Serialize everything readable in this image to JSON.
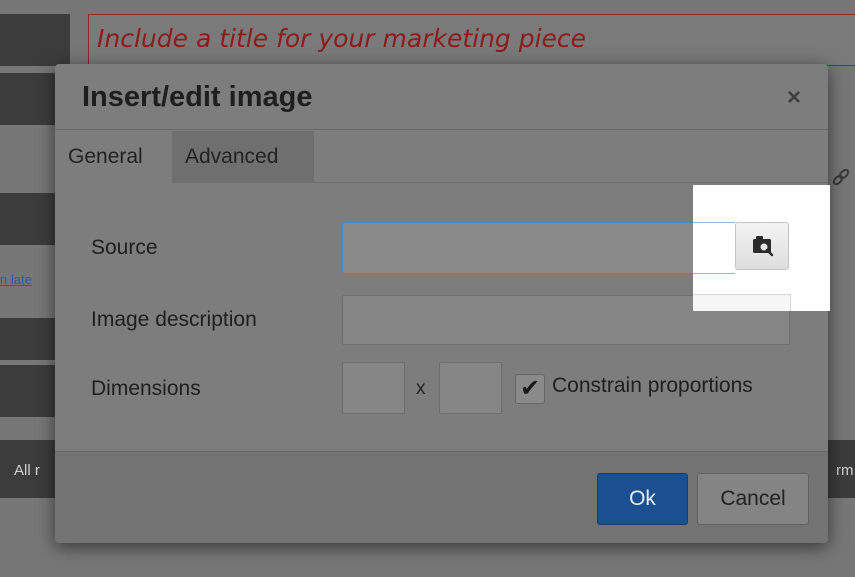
{
  "background": {
    "title_placeholder": "Include a title for your marketing piece",
    "left_link_fragment": "n late",
    "footer_left_fragment": "All r",
    "footer_right_fragment": "rm"
  },
  "dialog": {
    "title": "Insert/edit image",
    "close_icon": "close-icon",
    "tabs": [
      {
        "label": "General",
        "active": true
      },
      {
        "label": "Advanced",
        "active": false
      }
    ],
    "fields": {
      "source_label": "Source",
      "source_value": "",
      "browse_icon": "image-browse-icon",
      "description_label": "Image description",
      "description_value": "",
      "dimensions_label": "Dimensions",
      "width_value": "",
      "height_value": "",
      "separator": "x",
      "constrain_label": "Constrain proportions",
      "constrain_checked": true
    },
    "buttons": {
      "ok": "Ok",
      "cancel": "Cancel"
    }
  },
  "colors": {
    "primary_button": "#1a4f91",
    "title_placeholder": "#8e1a1a",
    "focus_border": "#5a84b0"
  }
}
